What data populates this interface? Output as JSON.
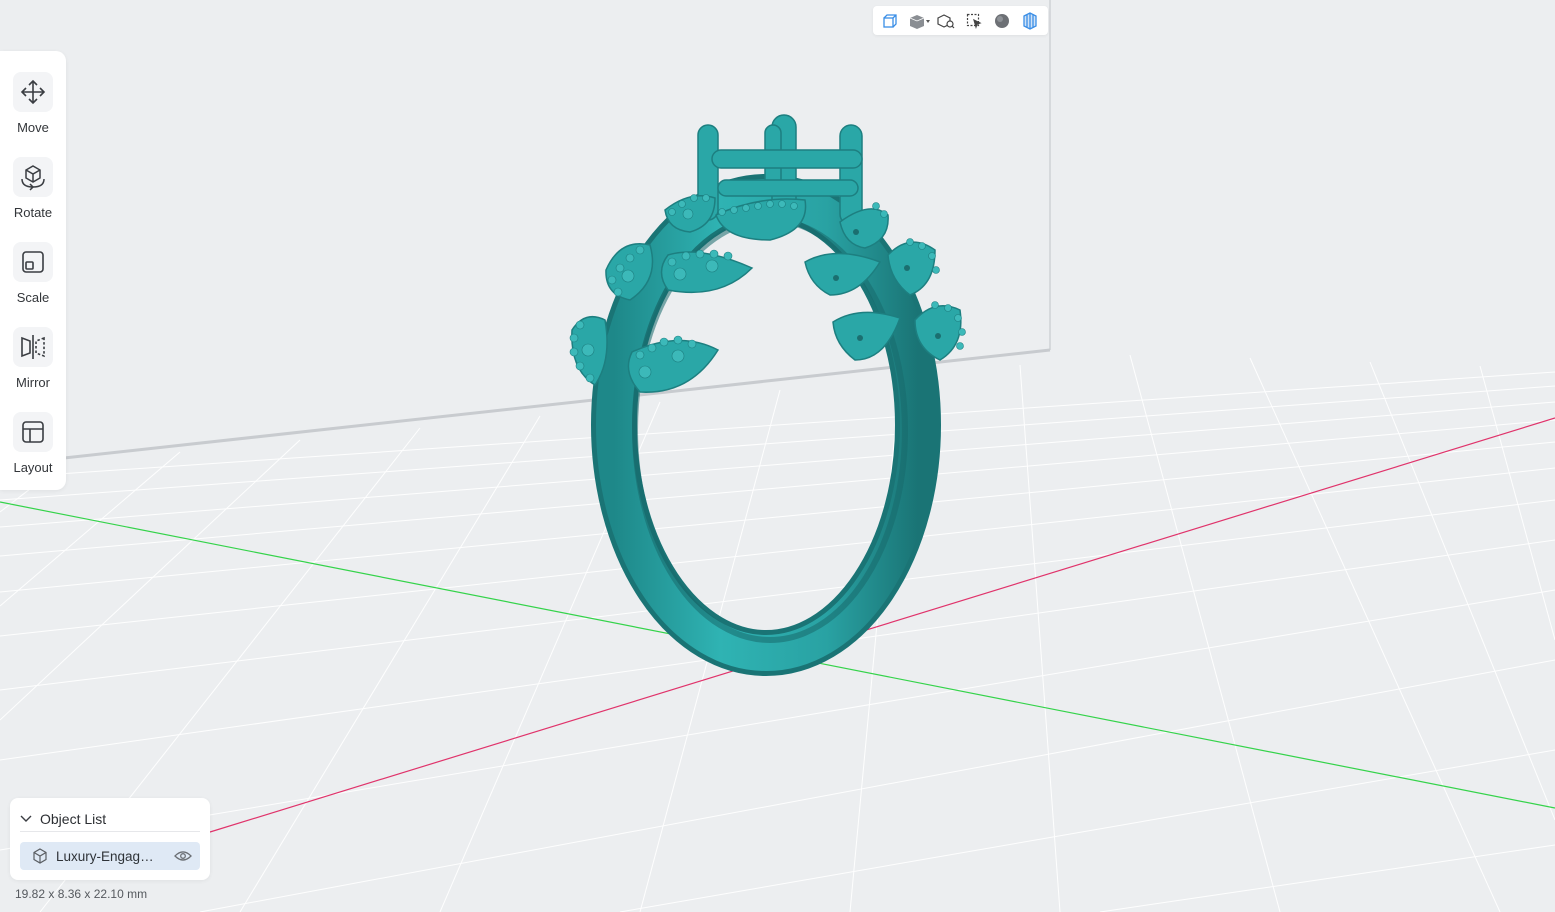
{
  "tools": [
    {
      "label": "Move",
      "icon": "move-icon"
    },
    {
      "label": "Rotate",
      "icon": "rotate-icon"
    },
    {
      "label": "Scale",
      "icon": "scale-icon"
    },
    {
      "label": "Mirror",
      "icon": "mirror-icon"
    },
    {
      "label": "Layout",
      "icon": "layout-icon"
    }
  ],
  "view_toolbar": {
    "buttons": [
      "perspective-view-icon",
      "standard-views-icon",
      "zoom-fit-icon",
      "select-region-icon",
      "shading-sphere-icon",
      "wireframe-icon"
    ]
  },
  "object_list": {
    "title": "Object List",
    "items": [
      {
        "name": "Luxury-Engagement-Ring",
        "icon": "cube-icon",
        "visibility_icon": "eye-icon"
      }
    ]
  },
  "dimensions": "19.82 x 8.36 x 22.10 mm",
  "colors": {
    "model": "#2aa7a7",
    "model_shade": "#1d7f80",
    "accent": "#3a8ee6",
    "x_axis": "#e0336b",
    "y_axis": "#34d34a",
    "grid": "#ffffff",
    "background": "#eceef0"
  }
}
